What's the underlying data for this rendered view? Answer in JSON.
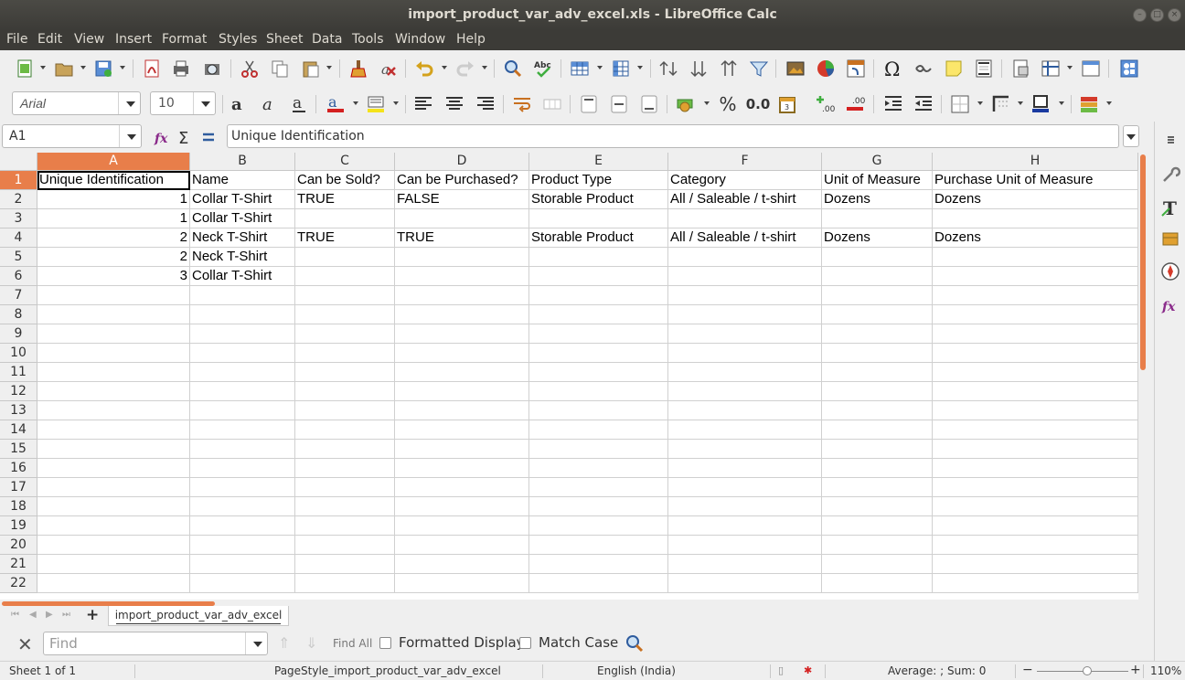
{
  "window": {
    "title": "import_product_var_adv_excel.xls - LibreOffice Calc"
  },
  "menu": [
    "File",
    "Edit",
    "View",
    "Insert",
    "Format",
    "Styles",
    "Sheet",
    "Data",
    "Tools",
    "Window",
    "Help"
  ],
  "toolbar": {
    "font_name": "Arial",
    "font_size": "10",
    "percent_label": "%",
    "number_label": "0.0"
  },
  "formula_bar": {
    "cell_ref": "A1",
    "content": "Unique Identification"
  },
  "grid": {
    "columns": [
      "A",
      "B",
      "C",
      "D",
      "E",
      "F",
      "G",
      "H"
    ],
    "selected_column": "A",
    "rows": [
      "1",
      "2",
      "3",
      "4",
      "5",
      "6",
      "7",
      "8",
      "9",
      "10",
      "11",
      "12",
      "13",
      "14",
      "15",
      "16",
      "17",
      "18",
      "19",
      "20",
      "21",
      "22"
    ],
    "selected_row": "1",
    "cells": [
      [
        "Unique Identification",
        "Name",
        "Can be Sold?",
        "Can be Purchased?",
        "Product Type",
        "Category",
        "Unit of Measure",
        "Purchase Unit of Measure"
      ],
      [
        "1",
        "Collar T-Shirt",
        "TRUE",
        "FALSE",
        "Storable Product",
        "All / Saleable / t-shirt",
        "Dozens",
        "Dozens"
      ],
      [
        "1",
        "Collar T-Shirt",
        "",
        "",
        "",
        "",
        "",
        ""
      ],
      [
        "2",
        "Neck T-Shirt",
        "TRUE",
        "TRUE",
        "Storable Product",
        "All / Saleable / t-shirt",
        "Dozens",
        "Dozens"
      ],
      [
        "2",
        "Neck T-Shirt",
        "",
        "",
        "",
        "",
        "",
        ""
      ],
      [
        "3",
        "Collar T-Shirt",
        "",
        "",
        "",
        "",
        "",
        ""
      ]
    ]
  },
  "sheet_tabs": [
    "import_product_var_adv_excel"
  ],
  "find_bar": {
    "placeholder": "Find",
    "find_all": "Find All",
    "formatted_display": "Formatted Display",
    "match_case": "Match Case"
  },
  "status_bar": {
    "sheet": "Sheet 1 of 1",
    "page_style": "PageStyle_import_product_var_adv_excel",
    "language": "English (India)",
    "summary": "Average: ; Sum: 0",
    "zoom": "110%",
    "zoom_level": 0.55
  },
  "colors": {
    "accent": "#e87e4a",
    "titlebar": "#3c3b37"
  }
}
